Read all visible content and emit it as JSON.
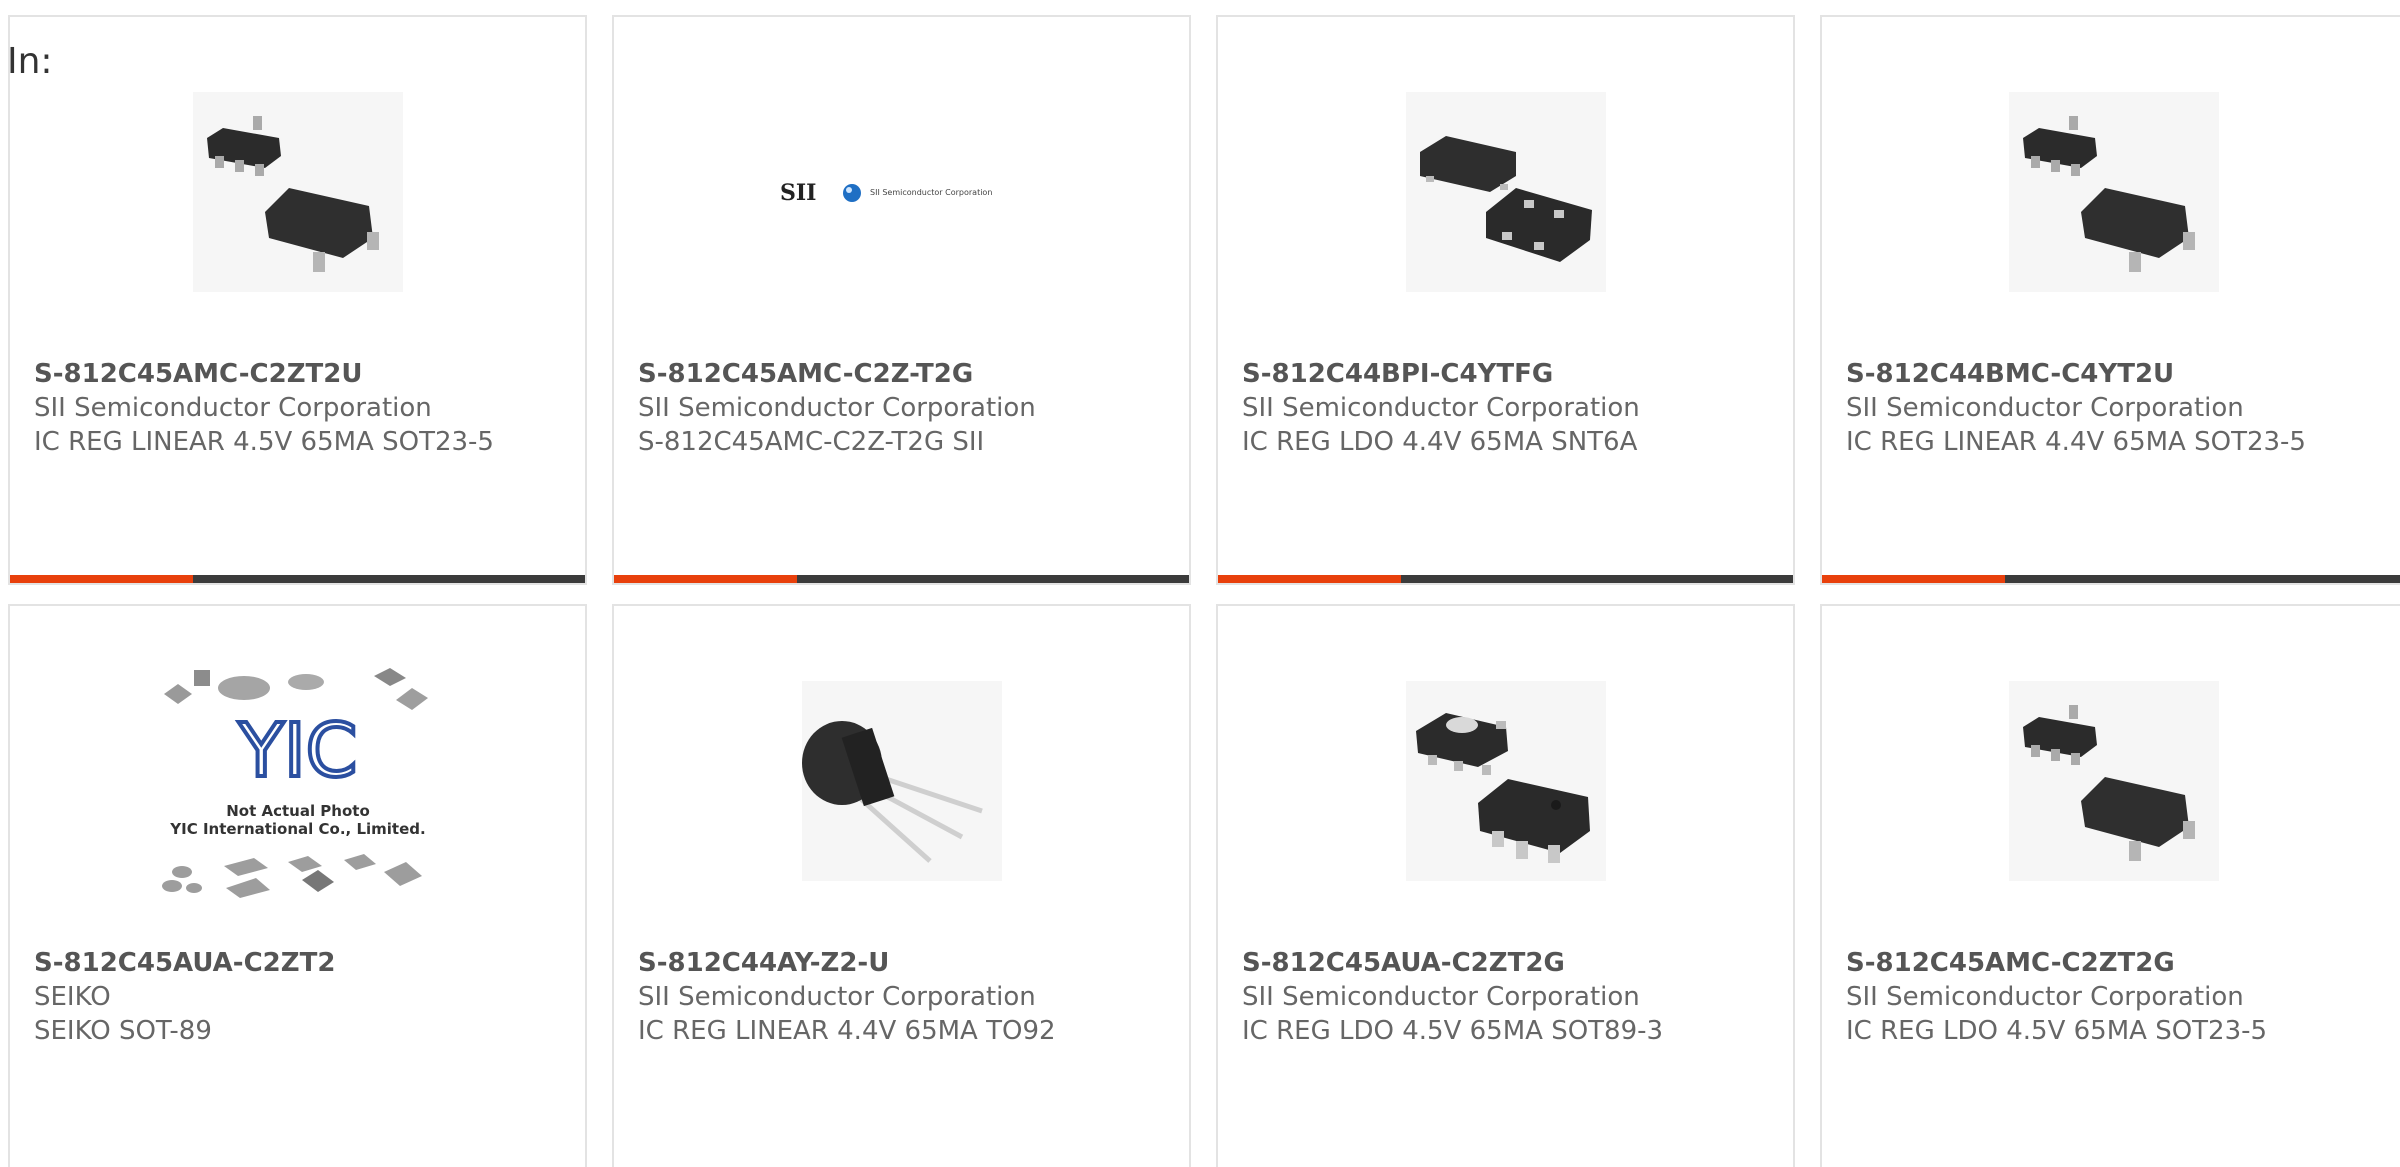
{
  "header": {
    "in_label": "In:"
  },
  "colors": {
    "accent": "#e8400c",
    "bar": "#3b3b3b",
    "border": "#e3e3e3",
    "text": "#666666"
  },
  "products": [
    {
      "part_number": "S-812C45AMC-C2ZT2U",
      "manufacturer": "SII Semiconductor Corporation",
      "description": "IC REG LINEAR 4.5V 65MA SOT23-5",
      "image": "sot23-5-package"
    },
    {
      "part_number": "S-812C45AMC-C2Z-T2G",
      "manufacturer": "SII Semiconductor Corporation",
      "description": "S-812C45AMC-C2Z-T2G SII",
      "image": "sii-logo",
      "logo_text": "SII",
      "logo_subtext": "SII Semiconductor Corporation"
    },
    {
      "part_number": "S-812C44BPI-C4YTFG",
      "manufacturer": "SII Semiconductor Corporation",
      "description": "IC REG LDO 4.4V 65MA SNT6A",
      "image": "snt6a-package"
    },
    {
      "part_number": "S-812C44BMC-C4YT2U",
      "manufacturer": "SII Semiconductor Corporation",
      "description": "IC REG LINEAR 4.4V 65MA SOT23-5",
      "image": "sot23-5-package"
    },
    {
      "part_number": "S-812C45AUA-C2ZT2",
      "manufacturer": "SEIKO",
      "description": "SEIKO SOT-89",
      "image": "yic-placeholder",
      "logo_text": "YIC",
      "placeholder_line1": "Not Actual Photo",
      "placeholder_line2": "YIC International Co., Limited."
    },
    {
      "part_number": "S-812C44AY-Z2-U",
      "manufacturer": "SII Semiconductor Corporation",
      "description": "IC REG LINEAR 4.4V 65MA TO92",
      "image": "to92-package"
    },
    {
      "part_number": "S-812C45AUA-C2ZT2G",
      "manufacturer": "SII Semiconductor Corporation",
      "description": "IC REG LDO 4.5V 65MA SOT89-3",
      "image": "sot89-3-package"
    },
    {
      "part_number": "S-812C45AMC-C2ZT2G",
      "manufacturer": "SII Semiconductor Corporation",
      "description": "IC REG LDO 4.5V 65MA SOT23-5",
      "image": "sot23-5-package"
    }
  ]
}
